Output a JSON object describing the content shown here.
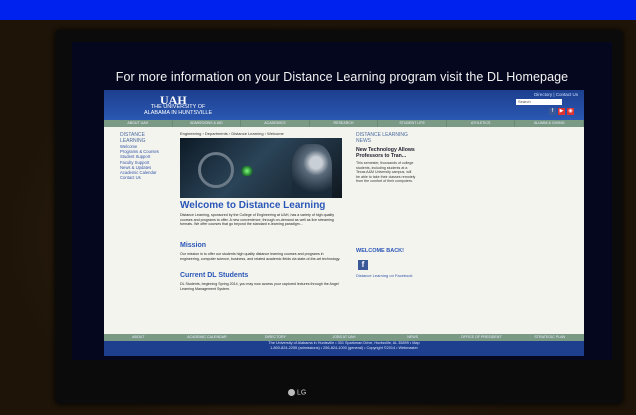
{
  "banner": "For more information on your Distance Learning program visit the DL Homepage",
  "site": {
    "logo": "UAH",
    "wordmark_line1": "THE UNIVERSITY OF",
    "wordmark_line2": "ALABAMA IN HUNTSVILLE",
    "header_links": "Directory | Contact Us",
    "search_label": "Search",
    "nav": [
      "ABOUT UAH",
      "ADMISSIONS & AID",
      "ACADEMICS",
      "RESEARCH",
      "STUDENT LIFE",
      "ATHLETICS",
      "ALUMNI & GIVING"
    ],
    "left_title": "DISTANCE LEARNING",
    "left_items": [
      "Welcome",
      "Programs & Courses",
      "Student Support",
      "Faculty Support",
      "News & Updates",
      "Academic Calendar",
      "Contact Us"
    ],
    "breadcrumb": "Engineering › Departments › Distance Learning › Welcome",
    "main_title": "Welcome to Distance Learning",
    "main_body": "Distance Learning, sponsored by the College of Engineering at UAH, has a variety of high quality courses and programs to offer. A new convenience, through on-demand as well as live streaming formats. We offer courses that go beyond the standard e-learning paradigm...",
    "mission_title": "Mission",
    "mission_body": "Our mission is to offer our students high quality distance learning courses and programs in engineering, computer science, business, and related academic fields via state-of-the-art technology.",
    "current_title": "Current DL Students",
    "current_body": "DL Students, beginning Spring 2014, you may now access your captured lectures through the Angel Learning Management System.",
    "news_title": "DISTANCE LEARNING NEWS",
    "news_headline": "New Technology Allows Professors to Tran...",
    "news_body": "This semester, thousands of college students, including students at a Texas A&M University campus, will be able to take their classes remotely from the comfort of their computers.",
    "welcome_back": "WELCOME BACK!",
    "facebook_link": "Distance Learning on Facebook",
    "footer_nav": [
      "ABOUT",
      "ACADEMIC CALENDAR",
      "DIRECTORY",
      "JOBS AT UAH",
      "NEWS",
      "OFFICE OF PRESIDENT",
      "STRATEGIC PLAN"
    ],
    "footer_line1": "The University of Alabama in Huntsville  •  301 Sparkman Drive, Huntsville, AL 35899  •  Map",
    "footer_line2": "1-800-824-2255 (admissions)  •  256-824-1000 (general)  •  Copyright ©2014  •  Webmaster"
  },
  "tv_brand": "LG"
}
